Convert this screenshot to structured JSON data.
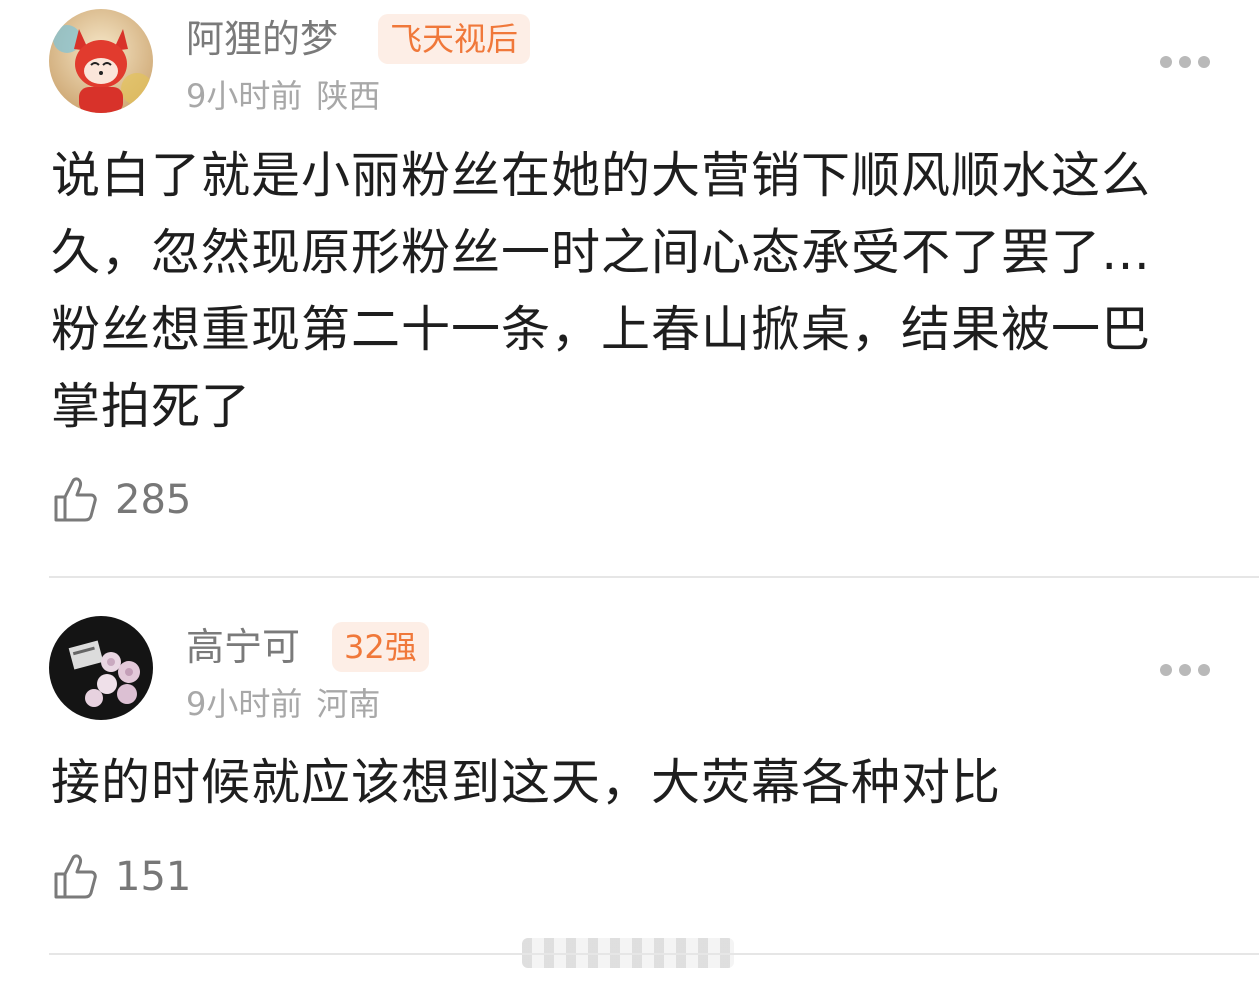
{
  "comments": [
    {
      "username": "阿狸的梦",
      "badge": "飞天视后",
      "time": "9小时前",
      "location": "陕西",
      "text_lines": [
        "说白了就是小丽粉丝在她的大营销下顺风顺水这么",
        "久，忽然现原形粉丝一时之间心态承受不了罢了…",
        "粉丝想重现第二十一条，上春山掀桌，结果被一巴",
        "掌拍死了"
      ],
      "likes": "285",
      "avatar_icon": "fox-avatar-icon"
    },
    {
      "username": "高宁可",
      "badge": "32强",
      "time": "9小时前",
      "location": "河南",
      "text_lines": [
        "接的时候就应该想到这天，大荧幕各种对比"
      ],
      "likes": "151",
      "avatar_icon": "roses-avatar-icon"
    }
  ],
  "colors": {
    "username": "#7a7a7a",
    "badge_text": "#f0783a",
    "badge_bg": "#fdeee6",
    "meta": "#a8a8a8",
    "body_text": "#1e1e1e"
  }
}
